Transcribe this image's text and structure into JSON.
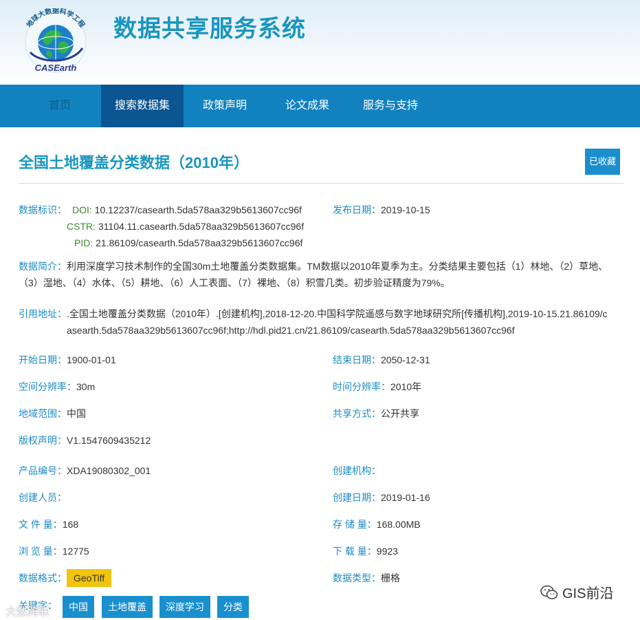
{
  "header": {
    "logo_arc_text": "地球大数据科学工程",
    "logo_text": "CASEarth",
    "site_title": "数据共享服务系统"
  },
  "nav": {
    "items": [
      {
        "label": "首页"
      },
      {
        "label": "搜索数据集"
      },
      {
        "label": "政策声明"
      },
      {
        "label": "论文成果"
      },
      {
        "label": "服务与支持"
      }
    ],
    "active": "搜索数据集"
  },
  "dataset": {
    "title": "全国土地覆盖分类数据（2010年）",
    "favorite_label": "已收藏",
    "id_label": "数据标识：",
    "doi_label": "DOI:",
    "doi": "10.12237/casearth.5da578aa329b5613607cc96f",
    "cstr_label": "CSTR:",
    "cstr": "31104.11.casearth.5da578aa329b5613607cc96f",
    "pid_label": "PID:",
    "pid": "21.86109/casearth.5da578aa329b5613607cc96f",
    "publish_label": "发布日期：",
    "publish_date": "2019-10-15",
    "summary_label": "数据简介：",
    "summary": "利用深度学习技术制作的全国30m土地覆盖分类数据集。TM数据以2010年夏季为主。分类结果主要包括（1）林地、（2）草地、（3）湿地、（4）水体、（5）耕地、（6）人工表面、（7）裸地、（8）积雪几类。初步验证精度为79%。",
    "cite_label": "引用地址：",
    "cite": ".全国土地覆盖分类数据（2010年）.[创建机构],2018-12-20.中国科学院遥感与数字地球研究所[传播机构],2019-10-15.21.86109/casearth.5da578aa329b5613607cc96f;http://hdl.pid21.cn/21.86109/casearth.5da578aa329b5613607cc96f",
    "start_label": "开始日期：",
    "start": "1900-01-01",
    "end_label": "结束日期：",
    "end": "2050-12-31",
    "spatial_label": "空间分辨率：",
    "spatial": "30m",
    "temporal_label": "时间分辨率：",
    "temporal": "2010年",
    "region_label": "地域范围：",
    "region": "中国",
    "share_label": "共享方式：",
    "share": "公开共享",
    "copyright_label": "版权声明：",
    "copyright": "V1.1547609435212",
    "product_label": "产品编号：",
    "product": "XDA19080302_001",
    "org_label": "创建机构：",
    "org": "",
    "creator_label": "创建人员：",
    "creator": "",
    "created_label": "创建日期：",
    "created": "2019-01-16",
    "filecount_label": "文 件 量：",
    "filecount": "168",
    "storage_label": "存 储 量：",
    "storage": "168.00MB",
    "views_label": "浏 览 量：",
    "views": "12775",
    "downloads_label": "下 载 量：",
    "downloads": "9923",
    "format_label": "数据格式：",
    "format": "GeoTiff",
    "datatype_label": "数据类型：",
    "datatype": "栅格",
    "keywords_label": "关键字：",
    "keywords": [
      "中国",
      "土地覆盖",
      "深度学习",
      "分类"
    ]
  },
  "overlay": {
    "watermark": "GIS前沿",
    "corner_text": "大数跨联"
  },
  "colors": {
    "accent": "#1996bf",
    "nav_bg": "#1281bf",
    "nav_active": "#0a5592",
    "label": "#1e8cc2",
    "tag": "#1a8fce",
    "format_tag": "#f1c40f"
  }
}
